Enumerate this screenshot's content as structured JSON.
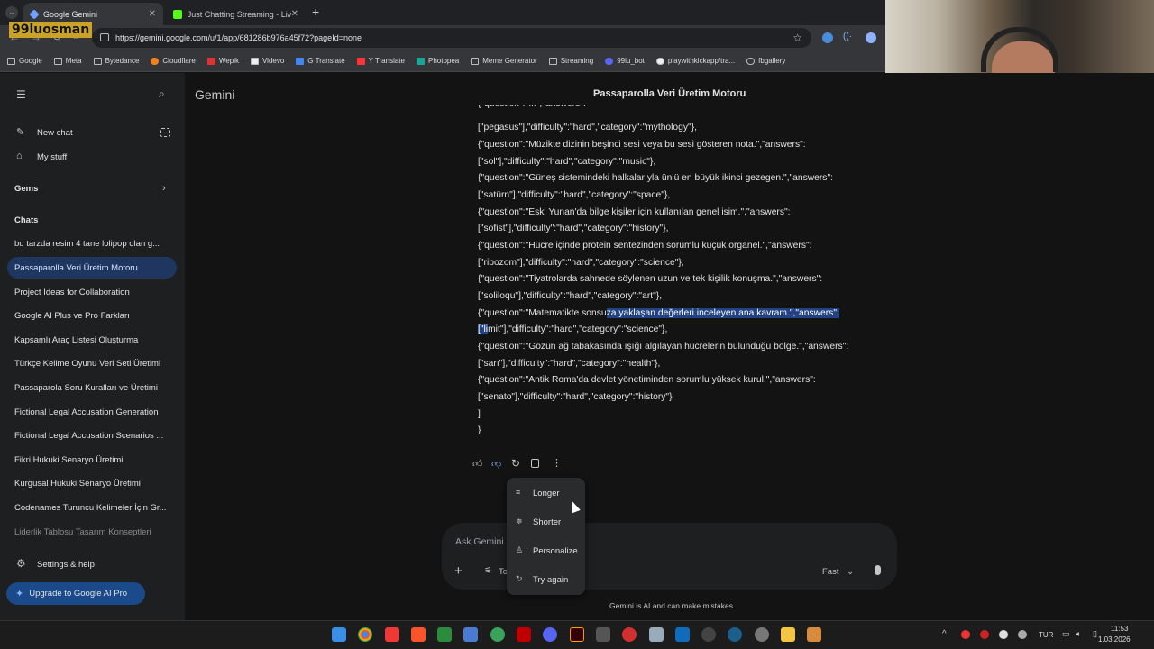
{
  "browser": {
    "tabs": [
      {
        "label": "Google Gemini",
        "active": true
      },
      {
        "label": "Just Chatting Streaming - Live",
        "active": false
      }
    ],
    "url": "https://gemini.google.com/u/1/app/681286b976a45f72?pageId=none",
    "bookmarks": [
      "Google",
      "Meta",
      "Bytedance",
      "Cloudflare",
      "Wepik",
      "Videvo",
      "G Translate",
      "Y Translate",
      "Photopea",
      "Meme Generator",
      "Streaming",
      "99lu_bot",
      "playwithkickapp/tra...",
      "fbgallery"
    ]
  },
  "overlay": {
    "streamer_tag": "99luosman"
  },
  "sidebar": {
    "app_name": "Gemini",
    "new_chat": "New chat",
    "my_stuff": "My stuff",
    "gems": "Gems",
    "chats_header": "Chats",
    "chats": [
      "bu tarzda resim 4 tane lolipop olan g...",
      "Passaparolla Veri Üretim Motoru",
      "Project Ideas for Collaboration",
      "Google AI Plus ve Pro Farkları",
      "Kapsamlı Araç Listesi Oluşturma",
      "Türkçe Kelime Oyunu Veri Seti Üretimi",
      "Passaparola Soru Kuralları ve Üretimi",
      "Fictional Legal Accusation Generation",
      "Fictional Legal Accusation Scenarios ...",
      "Fikri Hukuki Senaryo Üretimi",
      "Kurgusal Hukuki Senaryo Üretimi",
      "Codenames Turuncu Kelimeler İçin Gr...",
      "Liderlik Tablosu Tasarım Konseptleri"
    ],
    "settings": "Settings & help",
    "upgrade": "Upgrade to Google AI Pro"
  },
  "main": {
    "title": "Passaparolla Veri Üretim Motoru",
    "code_lines": [
      "[\"pegasus\"],\"difficulty\":\"hard\",\"category\":\"mythology\"},",
      "{\"question\":\"Müzikte dizinin beşinci sesi veya bu sesi gösteren nota.\",\"answers\":",
      "[\"sol\"],\"difficulty\":\"hard\",\"category\":\"music\"},",
      "{\"question\":\"Güneş sistemindeki halkalarıyla ünlü en büyük ikinci gezegen.\",\"answers\":",
      "[\"satürn\"],\"difficulty\":\"hard\",\"category\":\"space\"},",
      "{\"question\":\"Eski Yunan'da bilge kişiler için kullanılan genel isim.\",\"answers\":",
      "[\"sofist\"],\"difficulty\":\"hard\",\"category\":\"history\"},",
      "{\"question\":\"Hücre içinde protein sentezinden sorumlu küçük organel.\",\"answers\":",
      "[\"ribozom\"],\"difficulty\":\"hard\",\"category\":\"science\"},",
      "{\"question\":\"Tiyatrolarda sahnede söylenen uzun ve tek kişilik konuşma.\",\"answers\":",
      "[\"soliloqu\"],\"difficulty\":\"hard\",\"category\":\"art\"},"
    ],
    "hl_line_a": "{\"question\":\"Matematikte sonsu",
    "hl_line_b": "za yaklaşan değerleri inceleyen ana kavram.\",\"answers\":",
    "hl_line_c": "[\"li",
    "hl_line_d": "mit\"],\"difficulty\":\"hard\",\"category\":\"science\"},",
    "code_tail": [
      "{\"question\":\"Gözün ağ tabakasında ışığı algılayan hücrelerin bulunduğu bölge.\",\"answers\":",
      "[\"sarı\"],\"difficulty\":\"hard\",\"category\":\"health\"},",
      "{\"question\":\"Antik Roma'da devlet yönetiminden sorumlu yüksek kurul.\",\"answers\":",
      "[\"senato\"],\"difficulty\":\"hard\",\"category\":\"history\"}",
      "]",
      "}"
    ],
    "menu": [
      "Longer",
      "Shorter",
      "Personalize",
      "Try again"
    ],
    "input_placeholder": "Ask Gemini",
    "tools_label": "To",
    "mode": "Fast",
    "disclaimer": "Gemini is AI and can make mistakes."
  },
  "taskbar": {
    "lang": "TUR",
    "time": "11:53",
    "date": "1.03.2026"
  },
  "colors": {
    "accent": "#1f3760",
    "highlight": "#214283",
    "upgrade": "#1a4a8a"
  }
}
